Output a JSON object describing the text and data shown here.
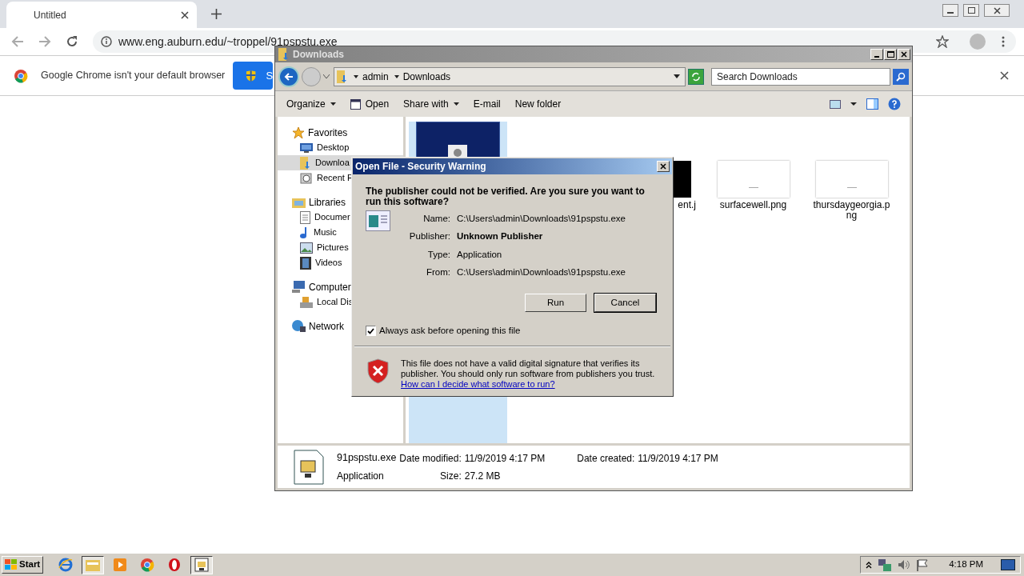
{
  "browser": {
    "tab": {
      "title": "Untitled"
    },
    "url": "www.eng.auburn.edu/~troppel/91pspstu.exe",
    "infobar": {
      "message": "Google Chrome isn't your default browser",
      "button": "S"
    }
  },
  "explorer": {
    "title": "Downloads",
    "breadcrumb": [
      "admin",
      "Downloads"
    ],
    "search": {
      "placeholder": "Search Downloads"
    },
    "toolbar": [
      {
        "label": "Organize",
        "kind": "menu"
      },
      {
        "label": "Open",
        "kind": "open"
      },
      {
        "label": "Share with",
        "kind": "menu"
      },
      {
        "label": "E-mail",
        "kind": "plain"
      },
      {
        "label": "New folder",
        "kind": "plain"
      }
    ],
    "sidebar": [
      {
        "label": "Favorites",
        "kind": "star",
        "children": [
          {
            "label": "Desktop",
            "kind": "desktop",
            "selected": false
          },
          {
            "label": "Downloa",
            "kind": "downloads",
            "selected": true
          },
          {
            "label": "Recent F",
            "kind": "recent",
            "selected": false
          }
        ]
      },
      {
        "label": "Libraries",
        "kind": "libraries",
        "children": [
          {
            "label": "Documer",
            "kind": "documents",
            "selected": false
          },
          {
            "label": "Music",
            "kind": "music",
            "selected": false
          },
          {
            "label": "Pictures",
            "kind": "pictures",
            "selected": false
          },
          {
            "label": "Videos",
            "kind": "videos",
            "selected": false
          }
        ]
      },
      {
        "label": "Computer",
        "kind": "computer",
        "children": [
          {
            "label": "Local Dis",
            "kind": "disk",
            "selected": false
          }
        ]
      },
      {
        "label": "Network",
        "kind": "network"
      }
    ],
    "files": [
      {
        "kind": "app",
        "selected": true
      },
      {
        "name": "ent.j",
        "kind": "dark",
        "selected": false
      },
      {
        "name": "surfacewell.png",
        "kind": "light",
        "selected": false
      },
      {
        "name": "thursdaygeorgia.png",
        "kind": "light",
        "selected": false
      }
    ],
    "details": {
      "name": "91pspstu.exe",
      "type": "Application",
      "fields": [
        {
          "label": "Date modified:",
          "value": "11/9/2019 4:17 PM"
        },
        {
          "label": "Size:",
          "value": "27.2 MB"
        },
        {
          "label": "Date created:",
          "value": "11/9/2019 4:17 PM"
        }
      ]
    }
  },
  "dialog": {
    "title": "Open File - Security Warning",
    "heading": "The publisher could not be verified.  Are you sure you want to run this software?",
    "fields": [
      {
        "label": "Name:",
        "value": "C:\\Users\\admin\\Downloads\\91pspstu.exe",
        "bold": false
      },
      {
        "label": "Publisher:",
        "value": "Unknown Publisher",
        "bold": true
      },
      {
        "label": "Type:",
        "value": "Application",
        "bold": false
      },
      {
        "label": "From:",
        "value": "C:\\Users\\admin\\Downloads\\91pspstu.exe",
        "bold": false
      }
    ],
    "buttons": [
      {
        "label": "Run",
        "default": false
      },
      {
        "label": "Cancel",
        "default": true
      }
    ],
    "checkbox": {
      "label": "Always ask before opening this file",
      "checked": true
    },
    "warning": "This file does not have a valid digital signature that verifies its publisher.  You should only run software from publishers you trust.",
    "link": "How can I decide what software to run?"
  },
  "taskbar": {
    "start": "Start",
    "apps": [
      {
        "kind": "ie",
        "selected": false
      },
      {
        "kind": "folder",
        "selected": true
      },
      {
        "kind": "media",
        "selected": false
      },
      {
        "kind": "chrome",
        "selected": false
      },
      {
        "kind": "opera",
        "selected": false
      },
      {
        "kind": "app",
        "selected": true
      }
    ],
    "clock": "4:18 PM"
  }
}
